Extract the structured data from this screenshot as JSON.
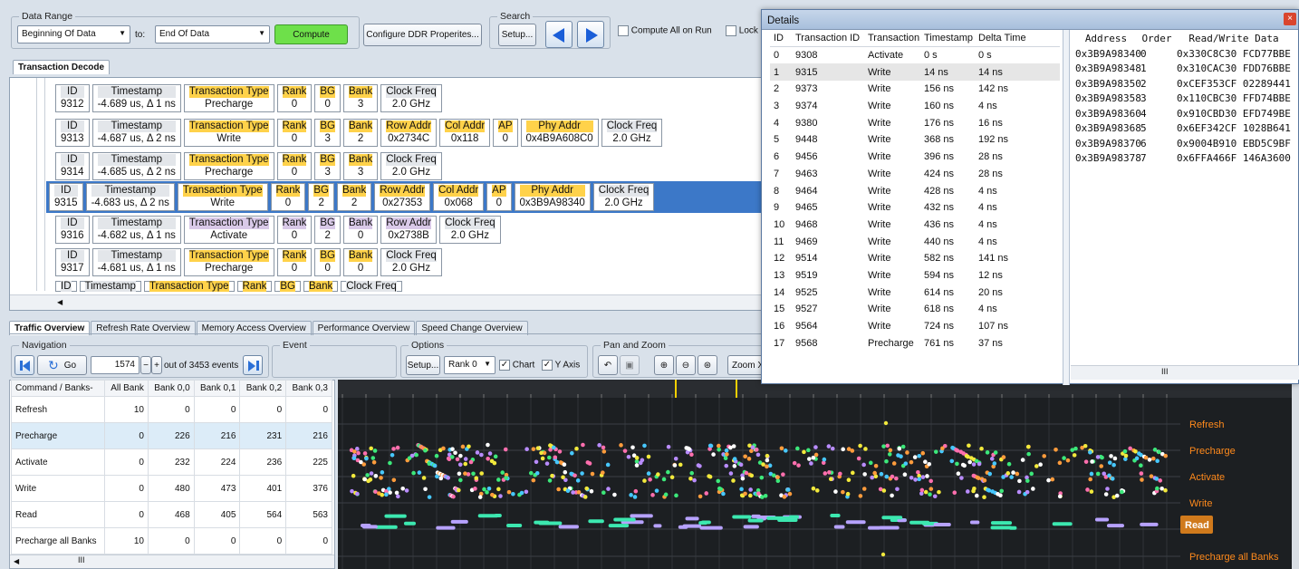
{
  "toolbar": {
    "data_range": "Data Range",
    "start": "Beginning Of Data",
    "to": "to:",
    "end": "End Of Data",
    "compute": "Compute",
    "configure": "Configure DDR Properites...",
    "search": "Search",
    "setup": "Setup...",
    "compute_all": "Compute All on Run",
    "lock": "Lock"
  },
  "decode_tab": "Transaction Decode",
  "decode_rows": [
    {
      "id": "9312",
      "ts": "-4.689 us, Δ 1 ns",
      "type": "Precharge",
      "rank": "0",
      "bg": "0",
      "bank": "3",
      "extras": [],
      "clock": "2.0 GHz",
      "accent": "gold"
    },
    {
      "id": "9313",
      "ts": "-4.687 us, Δ 2 ns",
      "type": "Write",
      "rank": "0",
      "bg": "3",
      "bank": "2",
      "extras": [
        [
          "Row Addr",
          "0x2734C"
        ],
        [
          "Col Addr",
          "0x118"
        ],
        [
          "AP",
          "0"
        ],
        [
          "Phy Addr",
          "0x4B9A608C0"
        ]
      ],
      "clock": "2.0 GHz",
      "accent": "gold"
    },
    {
      "id": "9314",
      "ts": "-4.685 us, Δ 2 ns",
      "type": "Precharge",
      "rank": "0",
      "bg": "3",
      "bank": "3",
      "extras": [],
      "clock": "2.0 GHz",
      "accent": "gold"
    },
    {
      "id": "9315",
      "ts": "-4.683 us, Δ 2 ns",
      "type": "Write",
      "rank": "0",
      "bg": "2",
      "bank": "2",
      "extras": [
        [
          "Row Addr",
          "0x27353"
        ],
        [
          "Col Addr",
          "0x068"
        ],
        [
          "AP",
          "0"
        ],
        [
          "Phy Addr",
          "0x3B9A98340"
        ]
      ],
      "clock": "2.0 GHz",
      "accent": "gold",
      "selected": true
    },
    {
      "id": "9316",
      "ts": "-4.682 us, Δ 1 ns",
      "type": "Activate",
      "rank": "0",
      "bg": "2",
      "bank": "0",
      "extras": [
        [
          "Row Addr",
          "0x2738B"
        ]
      ],
      "clock": "2.0 GHz",
      "accent": "lav"
    },
    {
      "id": "9317",
      "ts": "-4.681 us, Δ 1 ns",
      "type": "Precharge",
      "rank": "0",
      "bg": "0",
      "bank": "0",
      "extras": [],
      "clock": "2.0 GHz",
      "accent": "gold"
    }
  ],
  "labels": {
    "id": "ID",
    "ts": "Timestamp",
    "type": "Transaction Type",
    "rank": "Rank",
    "bg": "BG",
    "bank": "Bank",
    "clock": "Clock Freq"
  },
  "bottom_tabs": [
    "Traffic Overview",
    "Refresh Rate Overview",
    "Memory Access Overview",
    "Performance Overview",
    "Speed Change Overview"
  ],
  "nav": {
    "title": "Navigation",
    "go": "Go",
    "value": "1574",
    "out_of": "out of 3453 events",
    "event": "Event",
    "options": "Options",
    "setup": "Setup...",
    "rank": "Rank 0",
    "chart": "Chart",
    "yaxis": "Y Axis",
    "pan": "Pan and Zoom",
    "zoom": "Zoom X"
  },
  "overview": {
    "headers": [
      "Command / Banks-",
      "All Bank",
      "Bank 0,0",
      "Bank 0,1",
      "Bank 0,2",
      "Bank 0,3"
    ],
    "rows": [
      [
        "Refresh",
        "10",
        "0",
        "0",
        "0",
        "0"
      ],
      [
        "Precharge",
        "0",
        "226",
        "216",
        "231",
        "216"
      ],
      [
        "Activate",
        "0",
        "232",
        "224",
        "236",
        "225"
      ],
      [
        "Write",
        "0",
        "480",
        "473",
        "401",
        "376"
      ],
      [
        "Read",
        "0",
        "468",
        "405",
        "564",
        "563"
      ],
      [
        "Precharge all Banks",
        "10",
        "0",
        "0",
        "0",
        "0"
      ]
    ]
  },
  "chart_labels": [
    "Refresh",
    "Precharge",
    "Activate",
    "Write",
    "Read",
    "Precharge all Banks"
  ],
  "chart_marker": "Read",
  "details": {
    "title": "Details",
    "headers": [
      "ID",
      "Transaction ID",
      "Transaction",
      "Timestamp",
      "Delta Time"
    ],
    "rows": [
      [
        "0",
        "9308",
        "Activate",
        "0 s",
        "0 s"
      ],
      [
        "1",
        "9315",
        "Write",
        "14 ns",
        "14 ns"
      ],
      [
        "2",
        "9373",
        "Write",
        "156 ns",
        "142 ns"
      ],
      [
        "3",
        "9374",
        "Write",
        "160 ns",
        "4 ns"
      ],
      [
        "4",
        "9380",
        "Write",
        "176 ns",
        "16 ns"
      ],
      [
        "5",
        "9448",
        "Write",
        "368 ns",
        "192 ns"
      ],
      [
        "6",
        "9456",
        "Write",
        "396 ns",
        "28 ns"
      ],
      [
        "7",
        "9463",
        "Write",
        "424 ns",
        "28 ns"
      ],
      [
        "8",
        "9464",
        "Write",
        "428 ns",
        "4 ns"
      ],
      [
        "9",
        "9465",
        "Write",
        "432 ns",
        "4 ns"
      ],
      [
        "10",
        "9468",
        "Write",
        "436 ns",
        "4 ns"
      ],
      [
        "11",
        "9469",
        "Write",
        "440 ns",
        "4 ns"
      ],
      [
        "12",
        "9514",
        "Write",
        "582 ns",
        "141 ns"
      ],
      [
        "13",
        "9519",
        "Write",
        "594 ns",
        "12 ns"
      ],
      [
        "14",
        "9525",
        "Write",
        "614 ns",
        "20 ns"
      ],
      [
        "15",
        "9527",
        "Write",
        "618 ns",
        "4 ns"
      ],
      [
        "16",
        "9564",
        "Write",
        "724 ns",
        "107 ns"
      ],
      [
        "17",
        "9568",
        "Precharge",
        "761 ns",
        "37 ns"
      ]
    ],
    "addr_headers": [
      "Address",
      "Order",
      "Read/Write Data"
    ],
    "addr_rows": [
      [
        "0x3B9A98340",
        "0",
        "0x330C8C30 FCD77BBE"
      ],
      [
        "0x3B9A98348",
        "1",
        "0x310CAC30 FDD76BBE"
      ],
      [
        "0x3B9A98350",
        "2",
        "0xCEF353CF 02289441"
      ],
      [
        "0x3B9A98358",
        "3",
        "0x110CBC30 FFD74BBE"
      ],
      [
        "0x3B9A98360",
        "4",
        "0x910CBD30 EFD749BE"
      ],
      [
        "0x3B9A98368",
        "5",
        "0x6EF342CF 1028B641"
      ],
      [
        "0x3B9A98370",
        "6",
        "0x9004B910 EBD5C9BF"
      ],
      [
        "0x3B9A98378",
        "7",
        "0x6FFA466F 146A3600"
      ]
    ]
  },
  "colors": {
    "compute": "#6ee04a",
    "selection": "#3c78c8",
    "chart_bg": "#1c1f22",
    "accent_label": "#ff8a1c"
  }
}
